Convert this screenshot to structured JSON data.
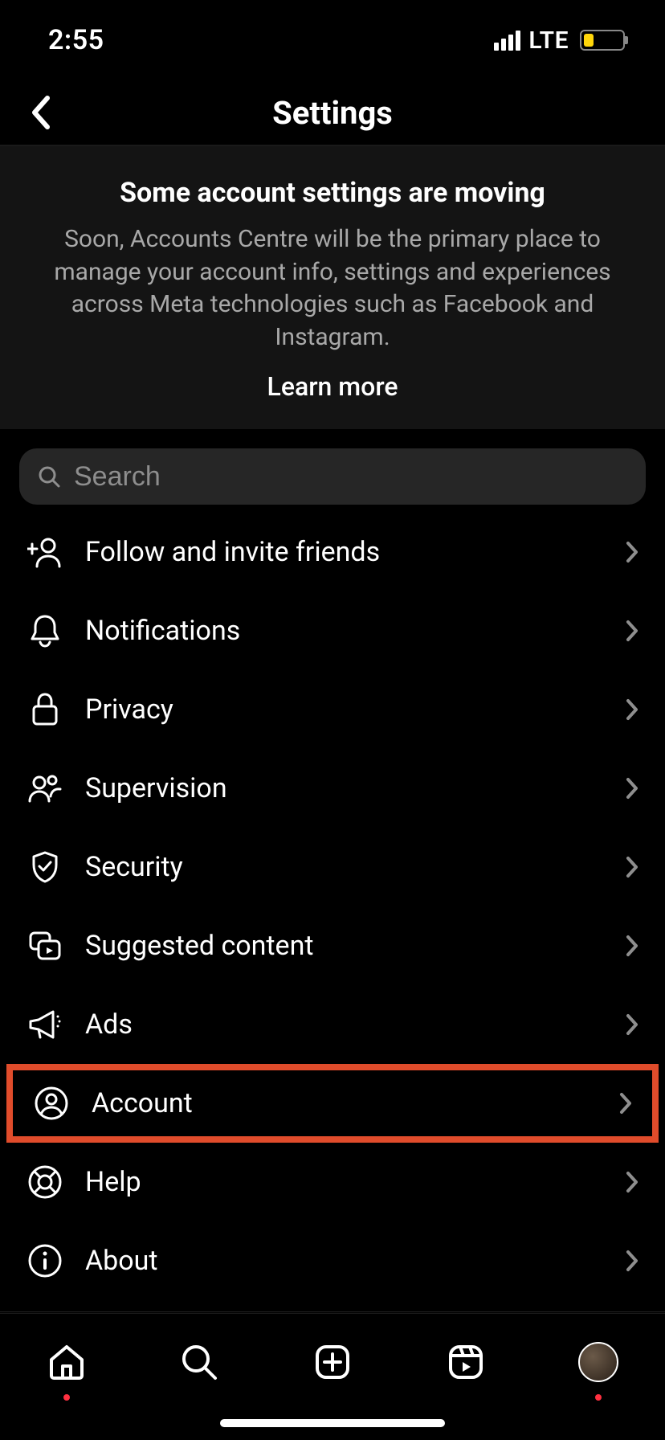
{
  "statusbar": {
    "time": "2:55",
    "network": "LTE"
  },
  "header": {
    "title": "Settings"
  },
  "banner": {
    "heading": "Some account settings are moving",
    "body": "Soon, Accounts Centre will be the primary place to manage your account info, settings and experiences across Meta technologies such as Facebook and Instagram.",
    "link": "Learn more"
  },
  "search": {
    "placeholder": "Search"
  },
  "items": [
    {
      "label": "Follow and invite friends"
    },
    {
      "label": "Notifications"
    },
    {
      "label": "Privacy"
    },
    {
      "label": "Supervision"
    },
    {
      "label": "Security"
    },
    {
      "label": "Suggested content"
    },
    {
      "label": "Ads"
    },
    {
      "label": "Account"
    },
    {
      "label": "Help"
    },
    {
      "label": "About"
    }
  ],
  "meta": {
    "brand": "Meta",
    "link": "Accounts Centre"
  }
}
